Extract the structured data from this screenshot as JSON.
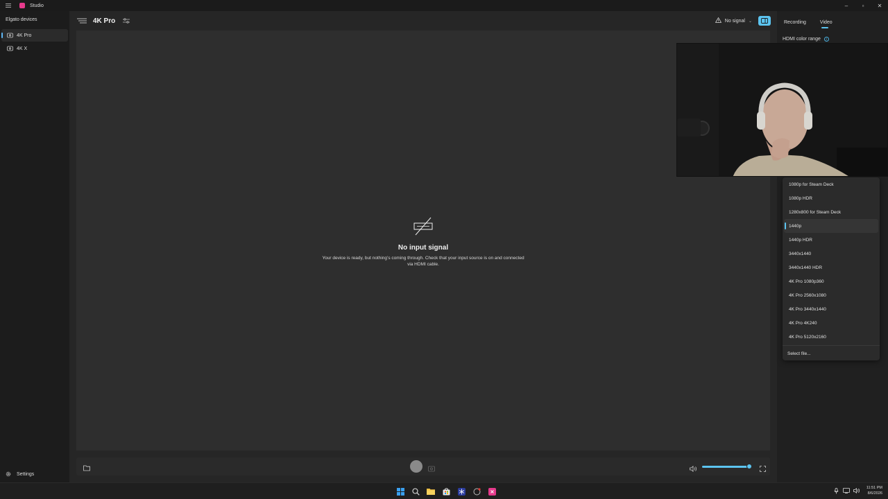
{
  "window": {
    "title": "Studio",
    "controls": [
      "–",
      "▫",
      "✕"
    ]
  },
  "sidebar": {
    "heading": "Elgato devices",
    "items": [
      {
        "label": "4K Pro",
        "active": true
      },
      {
        "label": "4K X",
        "active": false
      }
    ],
    "settings_label": "Settings"
  },
  "topbar": {
    "device_title": "4K Pro",
    "signal_label": "No signal",
    "signal_chevron": "⌄"
  },
  "preview": {
    "no_signal_title": "No input signal",
    "no_signal_desc_line1": "Your device is ready, but nothing’s coming through. Check that your input source is on and connected",
    "no_signal_desc_line2": "via HDMI cable."
  },
  "controls": {
    "volume_level": 0.95
  },
  "right_panel": {
    "tabs": [
      {
        "label": "Recording",
        "active": false
      },
      {
        "label": "Video",
        "active": true
      }
    ],
    "hdmi_color_range_label": "HDMI color range",
    "info_glyph": "i"
  },
  "edid_dropdown": {
    "items": [
      {
        "label": "1080p for Steam Deck",
        "selected": false
      },
      {
        "label": "1080p HDR",
        "selected": false
      },
      {
        "label": "1280x800 for Steam Deck",
        "selected": false
      },
      {
        "label": "1440p",
        "selected": true
      },
      {
        "label": "1440p HDR",
        "selected": false
      },
      {
        "label": "3440x1440",
        "selected": false
      },
      {
        "label": "3440x1440 HDR",
        "selected": false
      },
      {
        "label": "4K Pro 1080p360",
        "selected": false
      },
      {
        "label": "4K Pro 2560x1080",
        "selected": false
      },
      {
        "label": "4K Pro 3440x1440",
        "selected": false
      },
      {
        "label": "4K Pro 4K240",
        "selected": false
      },
      {
        "label": "4K Pro 5120x2160",
        "selected": false
      }
    ],
    "select_file_label": "Select file..."
  },
  "taskbar": {
    "time": "11:51 PM",
    "date": "8/6/2026"
  },
  "colors": {
    "accent": "#5cc4f0",
    "app_icon": "#e63a8c"
  }
}
